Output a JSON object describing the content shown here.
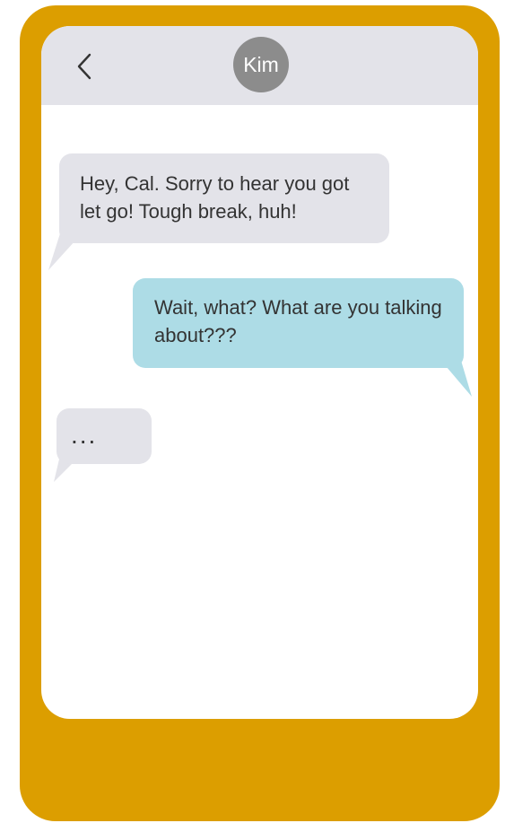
{
  "contact": {
    "name": "Kim"
  },
  "messages": [
    {
      "direction": "incoming",
      "text": "Hey, Cal. Sorry to hear you got let go! Tough break, huh!"
    },
    {
      "direction": "outgoing",
      "text": "Wait, what? What are you talking about???"
    }
  ],
  "typing_indicator": "...",
  "colors": {
    "frame": "#DC9E00",
    "header": "#E3E3E9",
    "incoming_bubble": "#E3E3E9",
    "outgoing_bubble": "#ADDCE6",
    "avatar": "#8C8C8C"
  },
  "icons": {
    "back": "chevron-left-icon"
  }
}
